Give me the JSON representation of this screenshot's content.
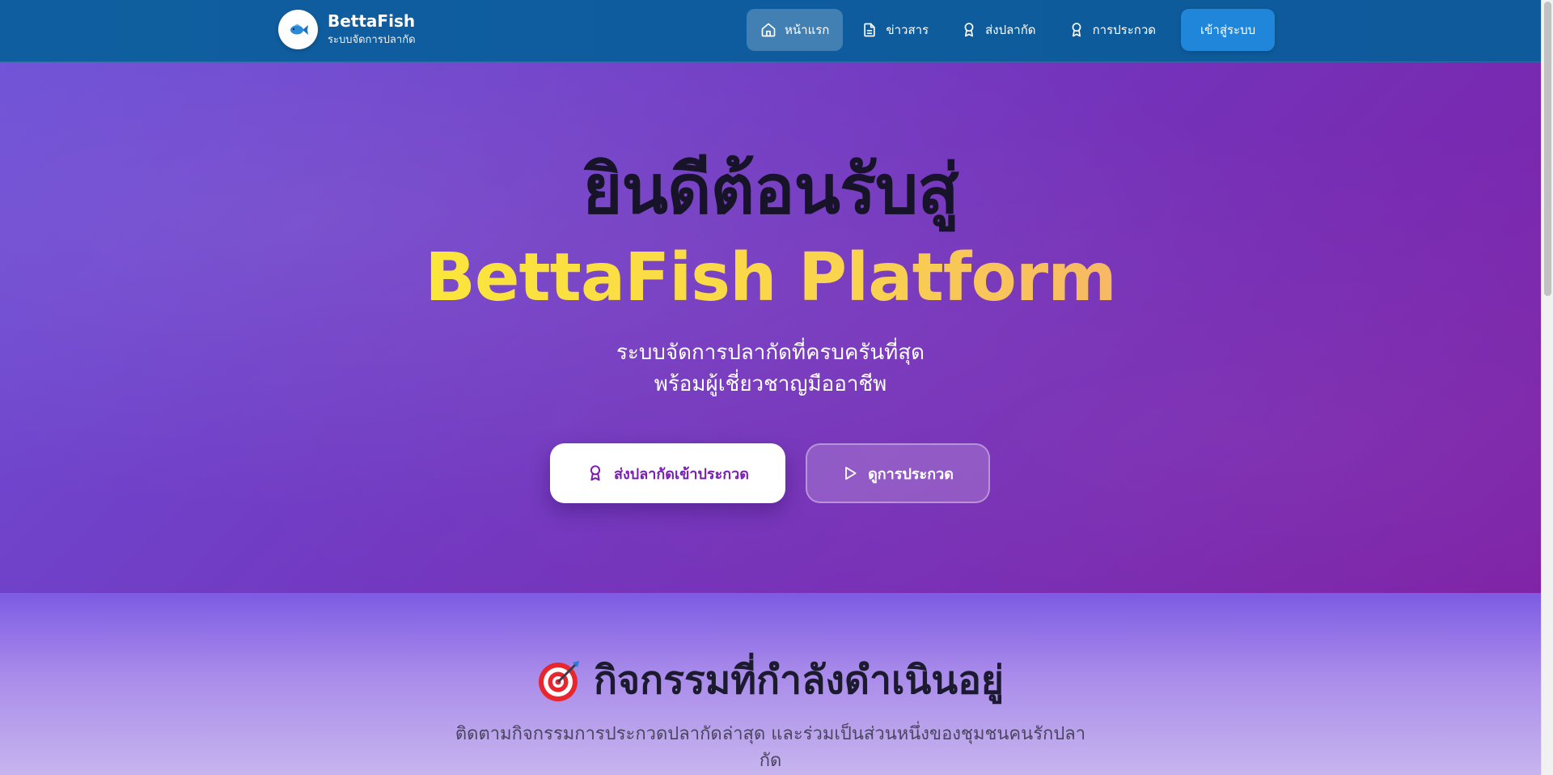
{
  "navbar": {
    "brand_name": "BettaFish",
    "brand_subtitle": "ระบบจัดการปลากัด",
    "brand_icon": "fish-icon",
    "items": [
      {
        "label": "หน้าแรก",
        "icon": "home-icon",
        "active": true
      },
      {
        "label": "ข่าวสาร",
        "icon": "document-icon",
        "active": false
      },
      {
        "label": "ส่งปลากัด",
        "icon": "award-icon",
        "active": false
      },
      {
        "label": "การประกวด",
        "icon": "award-icon",
        "active": false
      }
    ],
    "login_label": "เข้าสู่ระบบ"
  },
  "hero": {
    "title_line1": "ยินดีต้อนรับสู่",
    "title_line2": "BettaFish Platform",
    "subtitle_line1": "ระบบจัดการปลากัดที่ครบครันที่สุด",
    "subtitle_line2": "พร้อมผู้เชี่ยวชาญมืออาชีพ",
    "primary_button": "ส่งปลากัดเข้าประกวด",
    "secondary_button": "ดูการประกวด"
  },
  "activities": {
    "title": "กิจกรรมที่กำลังดำเนินอยู่",
    "title_icon": "target-icon",
    "description": "ติดตามกิจกรรมการประกวดปลากัดล่าสุด และร่วมเป็นส่วนหนึ่งของชุมชนคนรักปลากัด"
  },
  "colors": {
    "navbar": "#0f5e9f",
    "hero_start": "#6d4fd6",
    "hero_end": "#7d1fa5",
    "accent_yellow": "#f7de40",
    "login_button": "#1f86d9",
    "primary_button_text": "#7a1fb3"
  }
}
